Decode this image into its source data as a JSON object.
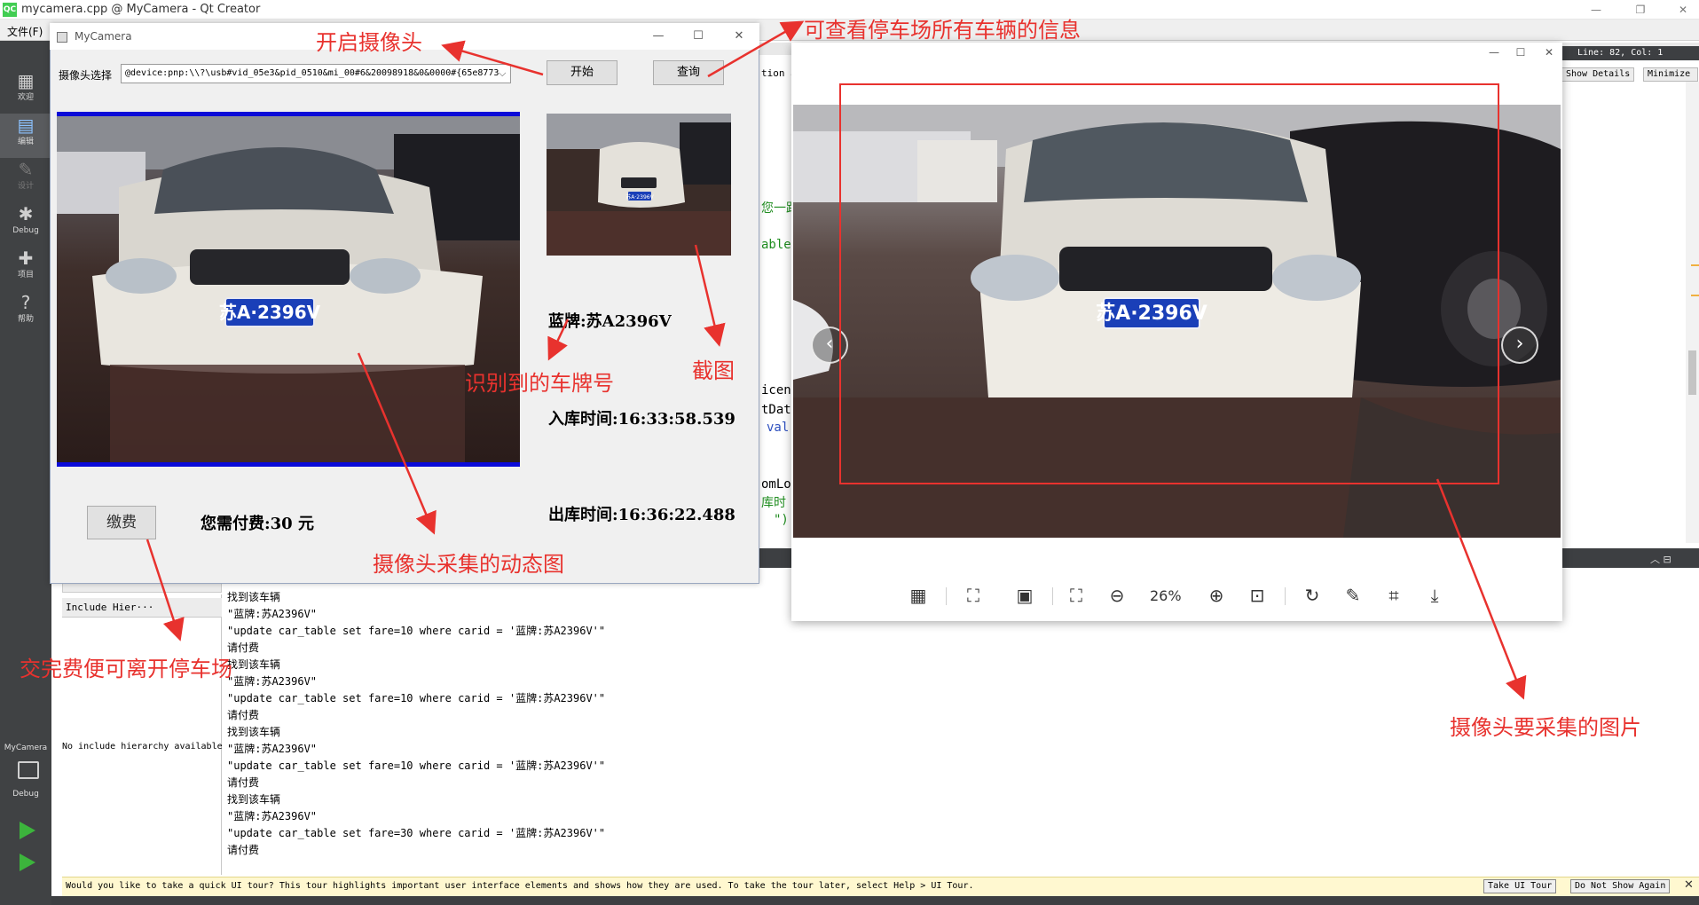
{
  "qt": {
    "window_title": "mycamera.cpp @ MyCamera - Qt Creator",
    "logo": "QC",
    "menu_file": "文件(F)",
    "sidebar": [
      {
        "label": "欢迎",
        "icon": "grid-icon"
      },
      {
        "label": "编辑",
        "icon": "edit-icon"
      },
      {
        "label": "设计",
        "icon": "pencil-icon"
      },
      {
        "label": "Debug",
        "icon": "bug-icon"
      },
      {
        "label": "项目",
        "icon": "wrench-icon"
      },
      {
        "label": "帮助",
        "icon": "help-icon"
      }
    ],
    "kit_name": "MyCamera",
    "kit_mode": "Debug",
    "editor_status": "Line: 82, Col: 1",
    "show_details": "Show Details",
    "minimize": "Minimize",
    "code_fragments": [
      "tion a",
      "您一路",
      "able",
      "icen",
      "tDat",
      "val",
      "omLo",
      "库时",
      "\")"
    ],
    "include_combo": "Include Hier···",
    "include_empty": "No include hierarchy available",
    "output_lines": [
      "找到该车辆",
      "\"蓝牌:苏A2396V\"",
      "\"update car_table set fare=10 where carid = '蓝牌:苏A2396V'\"",
      "请付费",
      "找到该车辆",
      "\"蓝牌:苏A2396V\"",
      "\"update car_table set fare=10 where carid = '蓝牌:苏A2396V'\"",
      "请付费",
      "找到该车辆",
      "\"蓝牌:苏A2396V\"",
      "\"update car_table set fare=10 where carid = '蓝牌:苏A2396V'\"",
      "请付费",
      "找到该车辆",
      "\"蓝牌:苏A2396V\"",
      "\"update car_table set fare=30 where carid = '蓝牌:苏A2396V'\"",
      "请付费"
    ],
    "tour_text": "Would you like to take a quick UI tour? This tour highlights important user interface elements and shows how they are used. To take the tour later, select Help > UI Tour.",
    "tour_button": "Take UI Tour",
    "no_show_button": "Do Not Show Again"
  },
  "camera_app": {
    "title": "MyCamera",
    "device_label": "摄像头选择",
    "device_value": "@device:pnp:\\\\?\\usb#vid_05e3&pid_0510&mi_00#6&20098918&0&0000#{65e8773",
    "start_button": "开始",
    "query_button": "查询",
    "plate": "蓝牌:苏A2396V",
    "in_time": "入库时间:16:33:58.539",
    "out_time": "出库时间:16:36:22.488",
    "pay_button": "缴费",
    "fee": "您需付费:30 元"
  },
  "viewer": {
    "zoom": "26%",
    "prev": "‹",
    "next": "›"
  },
  "photo": {
    "plate": "苏A·2396V",
    "snapshot_plate": "苏A·2396V"
  },
  "annotations": {
    "open_camera": "开启摄像头",
    "view_all": "可查看停车场所有车辆的信息",
    "plate_recognized": "识别到的车牌号",
    "screenshot": "截图",
    "dynamic_image": "摄像头采集的动态图",
    "pay_leave": "交完费便可离开停车场",
    "target_image": "摄像头要采集的图片"
  },
  "colors": {
    "annotation_red": "#e8322e",
    "frame_blue": "#0a0ad8",
    "plate_blue": "#1a3fb8",
    "qt_green": "#41cd52"
  }
}
